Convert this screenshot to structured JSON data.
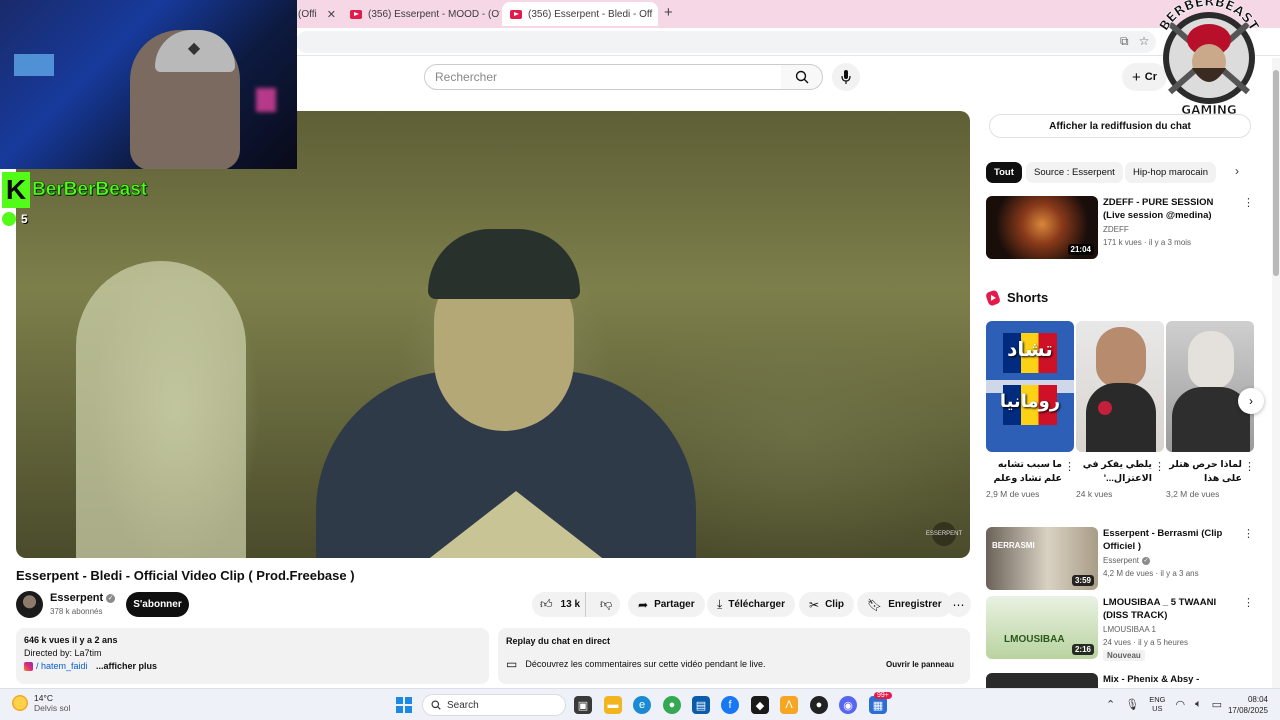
{
  "browser": {
    "tabs": [
      {
        "label": "(Offi"
      },
      {
        "label": "(356) Esserpent - MOOD - (Offi"
      },
      {
        "label": "(356) Esserpent - Bledi - Off"
      }
    ],
    "new_tab": "+"
  },
  "header": {
    "search_placeholder": "Rechercher",
    "create_label": "Cr"
  },
  "overlay": {
    "streamer_name": "BerBerBeast",
    "kick_letter": "K",
    "viewer_count": "5",
    "logo_top": "BERBERBEAST",
    "logo_bottom": "GAMING"
  },
  "player": {
    "watermark": "ESSERPENT"
  },
  "video": {
    "title": "Esserpent - Bledi - Official Video Clip ( Prod.Freebase )",
    "channel": "Esserpent",
    "subscribers": "378 k abonnés",
    "subscribe_label": "S'abonner",
    "likes": "13 k",
    "share_label": "Partager",
    "download_label": "Télécharger",
    "clip_label": "Clip",
    "save_label": "Enregistrer",
    "more": "⋯"
  },
  "description": {
    "stats": "646 k vues  il y a 2 ans",
    "directed": "Directed by: La7tim",
    "ig_handle": "/ hatem_faidi",
    "show_more": "...afficher plus"
  },
  "replay": {
    "title": "Replay du chat en direct",
    "text": "Découvrez les commentaires sur cette vidéo pendant le live.",
    "open_panel": "Ouvrir le panneau"
  },
  "sidebar": {
    "chat_replay_button": "Afficher la rediffusion du chat",
    "chips": [
      "Tout",
      "Source : Esserpent",
      "Hip-hop marocain"
    ],
    "recs": [
      {
        "title": "ZDEFF - PURE SESSION (Live session @medina)",
        "channel": "ZDEFF",
        "views": "171 k vues",
        "age": "il y a 3 mois",
        "duration": "21:04"
      },
      {
        "title": "Esserpent - Berrasmi (Clip Officiel )",
        "channel": "Esserpent",
        "views": "4,2 M de vues",
        "age": "il y a 3 ans",
        "duration": "3:59",
        "thumb_text": "BERRASMI"
      },
      {
        "title": "LMOUSIBAA _ 5 TWAANI (DISS TRACK)",
        "channel": "LMOUSIBAA 1",
        "views": "24 vues",
        "age": "il y a 5 heures",
        "duration": "2:16",
        "badge": "Nouveau",
        "thumb_text": "LMOUSIBAA"
      },
      {
        "title": "Mix - Phenix & Absy - Anarchy's"
      }
    ],
    "shorts_title": "Shorts",
    "shorts": [
      {
        "title": "ما سبب تشابه علم تشاد وعلم رومانيا",
        "views": "2,9 M de vues",
        "top_text": "تشاد",
        "bottom_text": "رومانيا"
      },
      {
        "title": "يلطي يفكر في الاعتزال...'",
        "views": "24 k vues"
      },
      {
        "title": "لماذا حرص هتلر على هذا الشارب...",
        "views": "3,2 M de vues"
      }
    ]
  },
  "taskbar": {
    "temperature": "14°C",
    "weather": "Delvis sol",
    "search": "Search",
    "lang_top": "ENG",
    "lang_bottom": "US",
    "time": "08:04",
    "date": "17/08/2025",
    "badge": "99+"
  },
  "colors": {
    "youtube_red": "#e21b4c",
    "kick_green": "#53fc18",
    "tab_strip": "#f5d7e6"
  }
}
